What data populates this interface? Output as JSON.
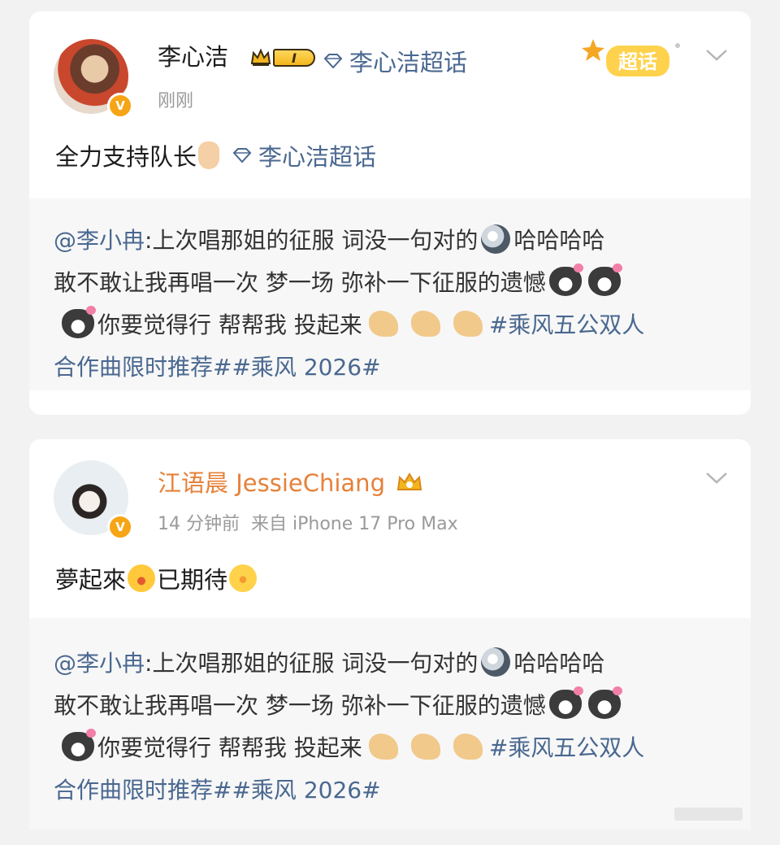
{
  "posts": [
    {
      "author": "李心洁",
      "level": "I",
      "topic_link": "李心洁超话",
      "supertopic_badge": "超话",
      "time": "刚刚",
      "text": "全力支持队长",
      "text_topic": "李心洁超话",
      "repost": {
        "mention": "@李小冉",
        "line1_a": ":上次唱那姐的征服 词没一句对的",
        "line1_b": "哈哈哈哈",
        "line2": "敢不敢让我再唱一次 梦一场 弥补一下征服的遗憾",
        "line3": "你要觉得行 帮帮我 投起来",
        "tag_a": "#乘风五公双人",
        "line4": "合作曲限时推荐##乘风 2026#"
      }
    },
    {
      "author": "江语晨 JessieChiang",
      "time": "14 分钟前",
      "source": "来自 iPhone 17 Pro Max",
      "text_a": "夢起來",
      "text_b": "已期待",
      "repost": {
        "mention": "@李小冉",
        "line1_a": ":上次唱那姐的征服 词没一句对的",
        "line1_b": "哈哈哈哈",
        "line2": "敢不敢让我再唱一次 梦一场 弥补一下征服的遗憾",
        "line3": "你要觉得行 帮帮我 投起来",
        "tag_a": "#乘风五公双人",
        "line4": "合作曲限时推荐##乘风 2026#"
      }
    }
  ],
  "colors": {
    "link": "#4a6890",
    "vip_name": "#e6813a",
    "meta": "#9a9a9a",
    "verified": "#f6a516"
  }
}
